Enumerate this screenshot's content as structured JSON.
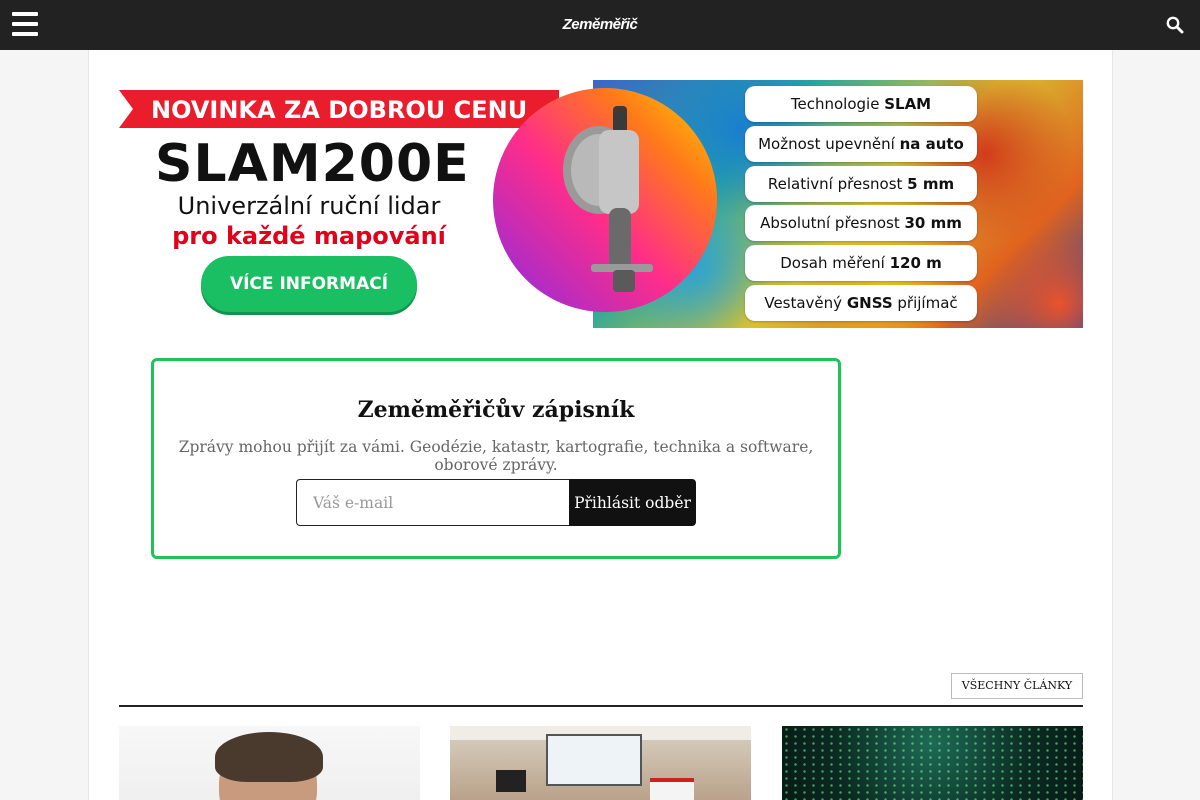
{
  "header": {
    "logo_text": "Zeměměřič",
    "menu_icon": "hamburger-menu-icon",
    "search_icon": "search-icon"
  },
  "banner": {
    "headline": "NOVINKA ZA DOBROU CENU",
    "model": "SLAM200E",
    "subtitle": "Univerzální ruční lidar",
    "subtitle_highlight": "pro každé mapování",
    "cta": "VÍCE INFORMACÍ",
    "features": [
      {
        "text": "Technologie ",
        "bold": "SLAM",
        "after": ""
      },
      {
        "text": "Možnost upevnění ",
        "bold": "na auto",
        "after": ""
      },
      {
        "text": "Relativní přesnost ",
        "bold": "5 mm",
        "after": ""
      },
      {
        "text": "Absolutní přesnost ",
        "bold": "30 mm",
        "after": ""
      },
      {
        "text": "Dosah měření ",
        "bold": "120 m",
        "after": ""
      },
      {
        "text": "Vestavěný ",
        "bold": "GNSS",
        "after": " přijímač"
      }
    ],
    "colors": {
      "red": "#ea1d2c",
      "green": "#1abf63"
    }
  },
  "subscribe": {
    "title": "Zeměměřičův zápisník",
    "description": "Zprávy mohou přijít za vámi. Geodézie, katastr, kartografie, technika a software, oborové zprávy.",
    "email_placeholder": "Váš e-mail",
    "email_value": "",
    "button_label": "Přihlásit odběr",
    "border_color": "#1fc456"
  },
  "articles": {
    "all_label": "VŠECHNY ČLÁNKY"
  }
}
